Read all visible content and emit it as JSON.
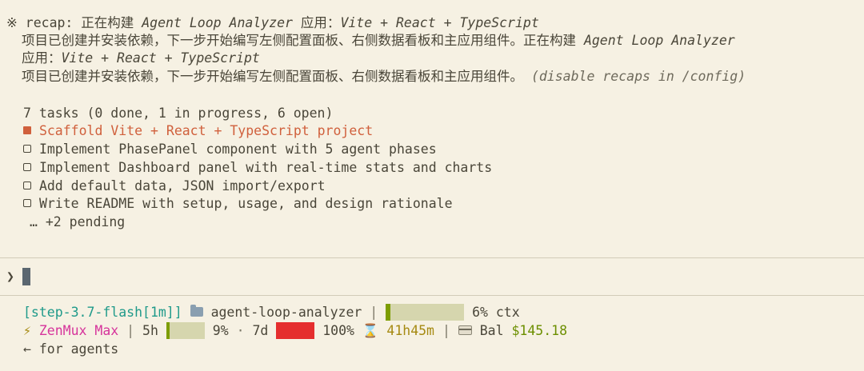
{
  "recap": {
    "bullet": "※",
    "line1_prefix": "recap: 正在构建 ",
    "line1_app": "Agent Loop Analyzer",
    "line1_mid": " 应用：",
    "line1_stack": "Vite + React + TypeScript",
    "line2_text": "项目已创建并安装依赖，下一步开始编写左侧配置面板、右侧数据看板和主应用组件。正在构建 ",
    "line2_app": "Agent Loop Analyzer",
    "line3_prefix": "应用：",
    "line3_stack": "Vite + React + TypeScript",
    "line4_text": "项目已创建并安装依赖，下一步开始编写左侧配置面板、右侧数据看板和主应用组件。 ",
    "line4_hint": "(disable recaps in /config)"
  },
  "tasks": {
    "summary": "7 tasks (0 done, 1 in progress, 6 open)",
    "items": [
      {
        "label": "Scaffold Vite + React + TypeScript project",
        "status": "in_progress"
      },
      {
        "label": "Implement PhasePanel component with 5 agent phases",
        "status": "open"
      },
      {
        "label": "Implement Dashboard panel with real-time stats and charts",
        "status": "open"
      },
      {
        "label": "Add default data, JSON import/export",
        "status": "open"
      },
      {
        "label": "Write README with setup, usage, and design rationale",
        "status": "open"
      }
    ],
    "more": "… +2 pending"
  },
  "prompt": {
    "symbol": "❯",
    "value": ""
  },
  "status": {
    "model": "[step-3.7-flash[1m]]",
    "project": "agent-loop-analyzer",
    "sep": "|",
    "ctx_percent": 6,
    "ctx_label": "6% ctx",
    "zap": "⚡",
    "plan": "ZenMux Max",
    "window_5h_label": "5h",
    "window_5h_percent": 9,
    "window_5h_text": "9%",
    "dot": "·",
    "window_7d_label": "7d",
    "window_7d_percent": 100,
    "window_7d_text": "100%",
    "hourglass": "⌛",
    "reset_time": "41h45m",
    "bal_label": "Bal",
    "balance": "$145.18",
    "hint": "← for agents"
  },
  "colors": {
    "background": "#f6f1e3",
    "text": "#4a4639",
    "accent_orange": "#d0603c",
    "teal": "#1f9a8a",
    "magenta": "#d6349b",
    "gold": "#a68a12",
    "green": "#6c8f00",
    "bar_track": "#d6d6ae",
    "bar_green": "#7d9d00",
    "bar_red": "#e52e2e"
  }
}
